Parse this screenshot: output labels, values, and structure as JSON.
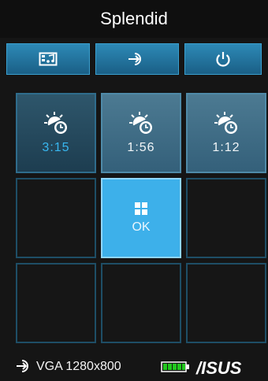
{
  "app": {
    "title": "Splendid"
  },
  "toolbar": {
    "buttons": [
      {
        "icon": "picture-music-icon"
      },
      {
        "icon": "input-source-icon"
      },
      {
        "icon": "power-icon"
      }
    ]
  },
  "profiles": [
    {
      "icon": "sun-clock-icon",
      "time": "3:15",
      "state": "selected"
    },
    {
      "icon": "sun-clock-icon",
      "time": "1:56"
    },
    {
      "icon": "sun-clock-icon",
      "time": "1:12"
    }
  ],
  "ok": {
    "icon": "four-squares-icon",
    "label": "OK"
  },
  "status": {
    "source_icon": "input-source-icon",
    "source_text": "VGA 1280x800",
    "battery_icon": "battery-full-icon",
    "brand": "/ISUS"
  },
  "colors": {
    "accent": "#3db0ea",
    "toolbar": "#2d89b6",
    "battery": "#22c81e",
    "background": "#151515"
  }
}
